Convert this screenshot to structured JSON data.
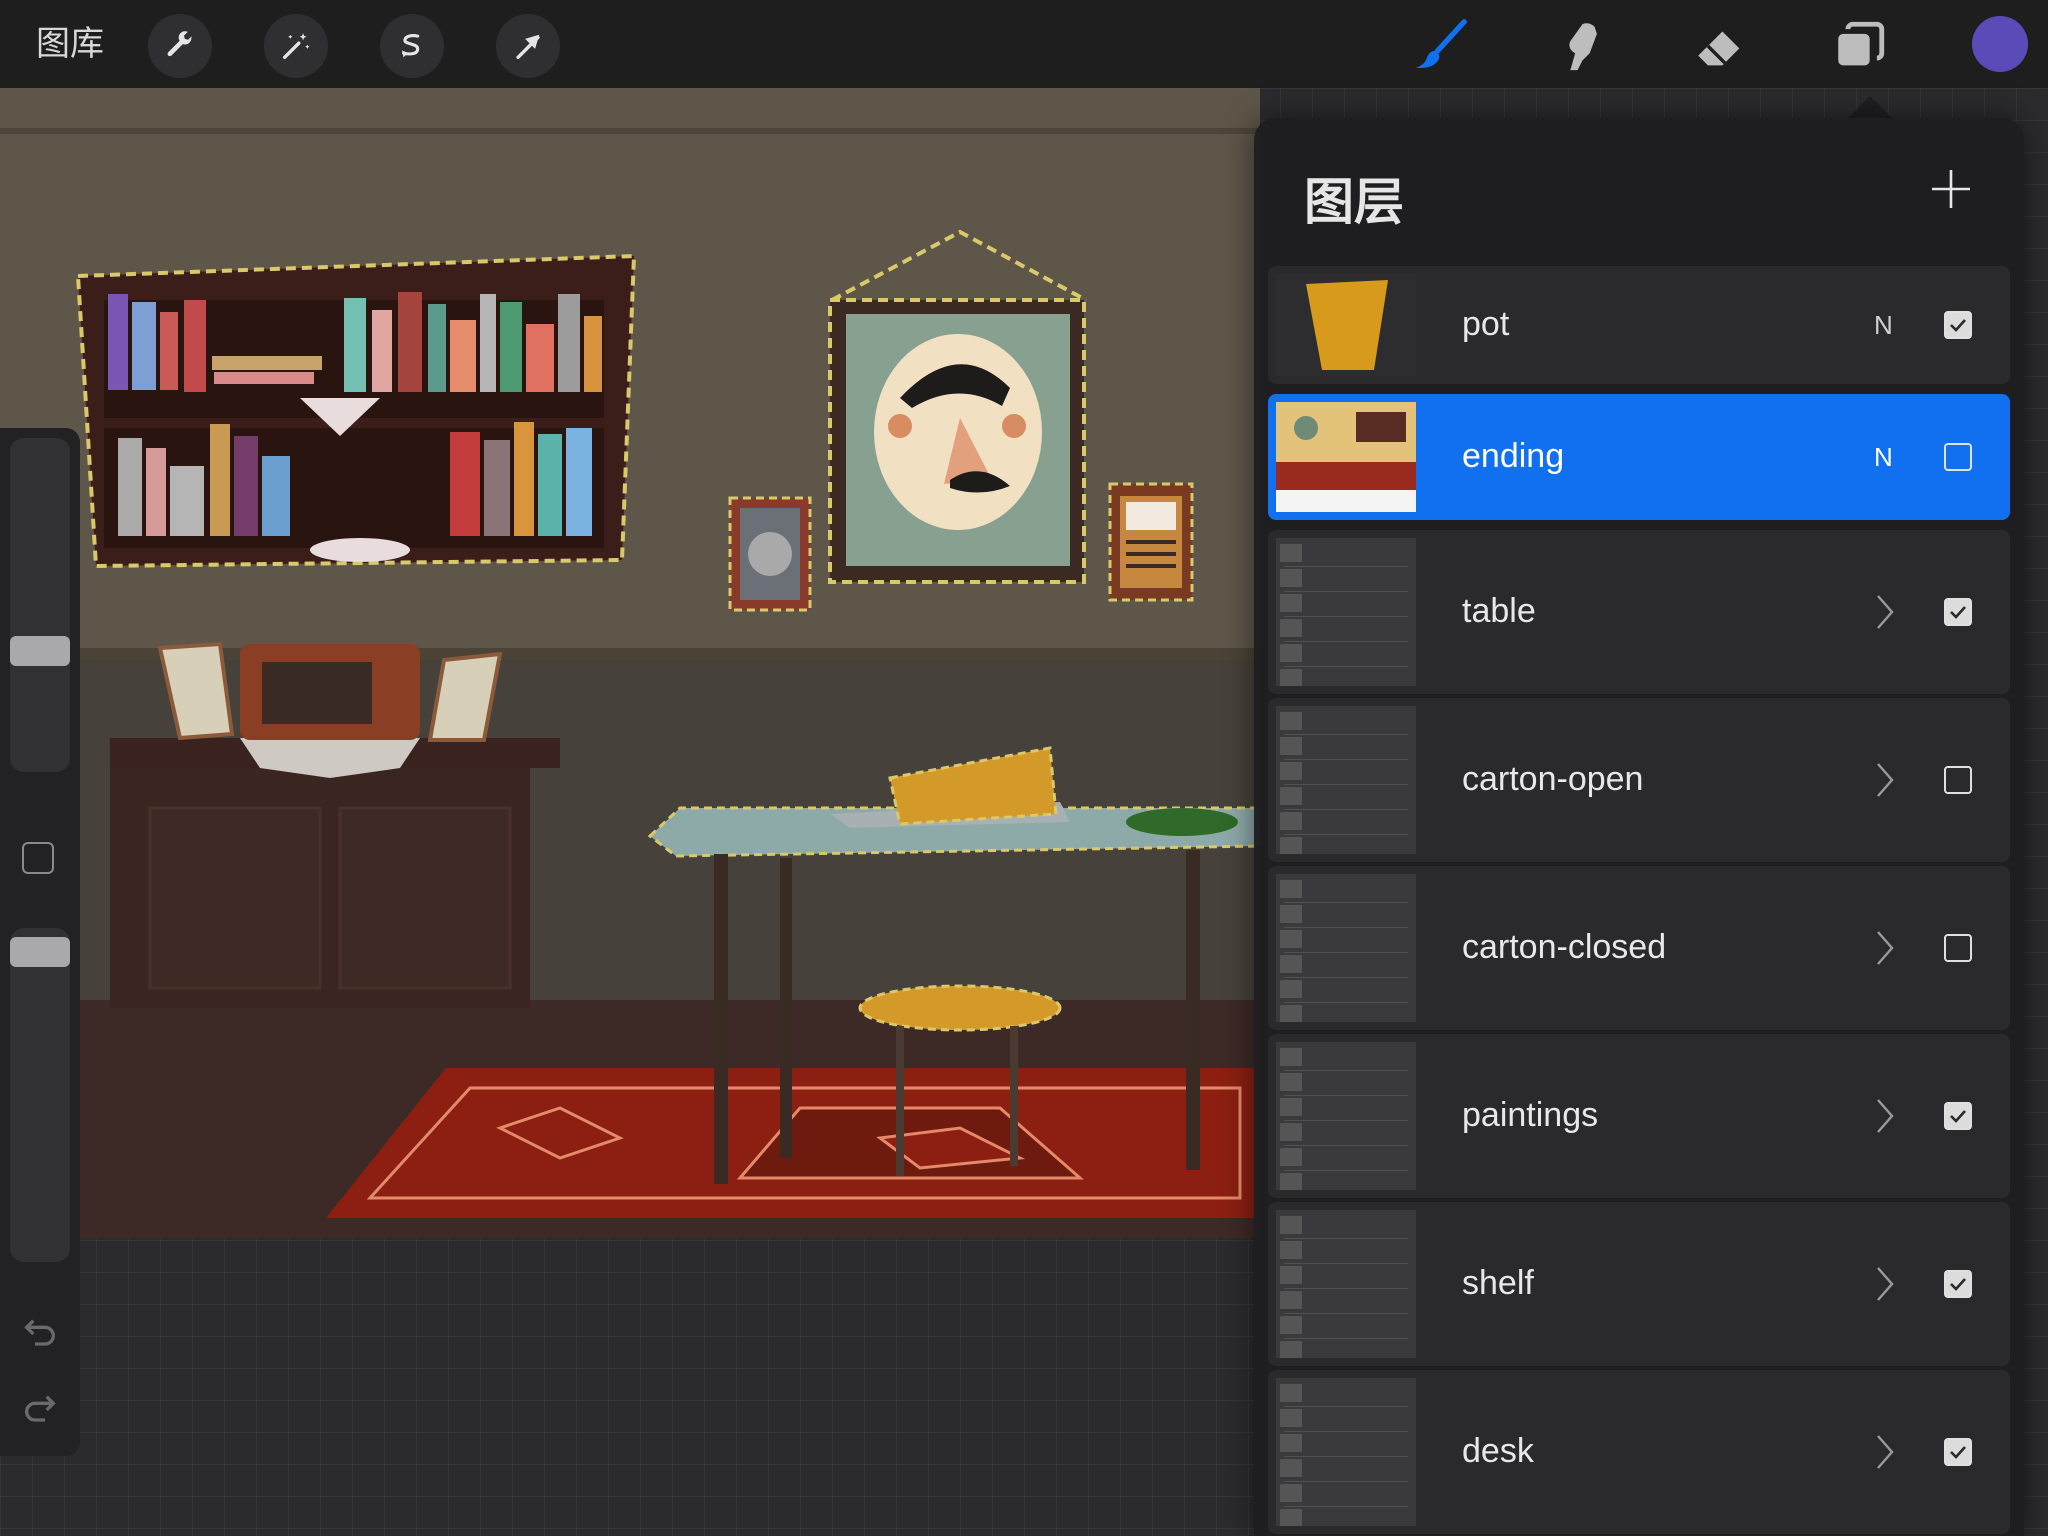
{
  "toolbar": {
    "gallery_label": "图库",
    "tools_left": [
      "wrench-icon",
      "magic-wand-icon",
      "selection-icon",
      "transform-arrow-icon"
    ],
    "tools_right": [
      "brush-icon",
      "smudge-icon",
      "eraser-icon",
      "layers-icon"
    ],
    "active_tool": "brush-icon",
    "accent_color": "#1170f0",
    "current_color": "#5a4bb8"
  },
  "layers_panel": {
    "title": "图层",
    "layers": [
      {
        "name": "pot",
        "blend": "N",
        "visible": true,
        "group": false,
        "selected": false
      },
      {
        "name": "ending",
        "blend": "N",
        "visible": false,
        "group": false,
        "selected": true
      },
      {
        "name": "table",
        "blend": "",
        "visible": true,
        "group": true,
        "selected": false
      },
      {
        "name": "carton-open",
        "blend": "",
        "visible": false,
        "group": true,
        "selected": false
      },
      {
        "name": "carton-closed",
        "blend": "",
        "visible": false,
        "group": true,
        "selected": false
      },
      {
        "name": "paintings",
        "blend": "",
        "visible": true,
        "group": true,
        "selected": false
      },
      {
        "name": "shelf",
        "blend": "",
        "visible": true,
        "group": true,
        "selected": false
      },
      {
        "name": "desk",
        "blend": "",
        "visible": true,
        "group": true,
        "selected": false
      }
    ]
  },
  "sidebar": {
    "brush_size_level": 0.35,
    "opacity_level": 0.97
  }
}
